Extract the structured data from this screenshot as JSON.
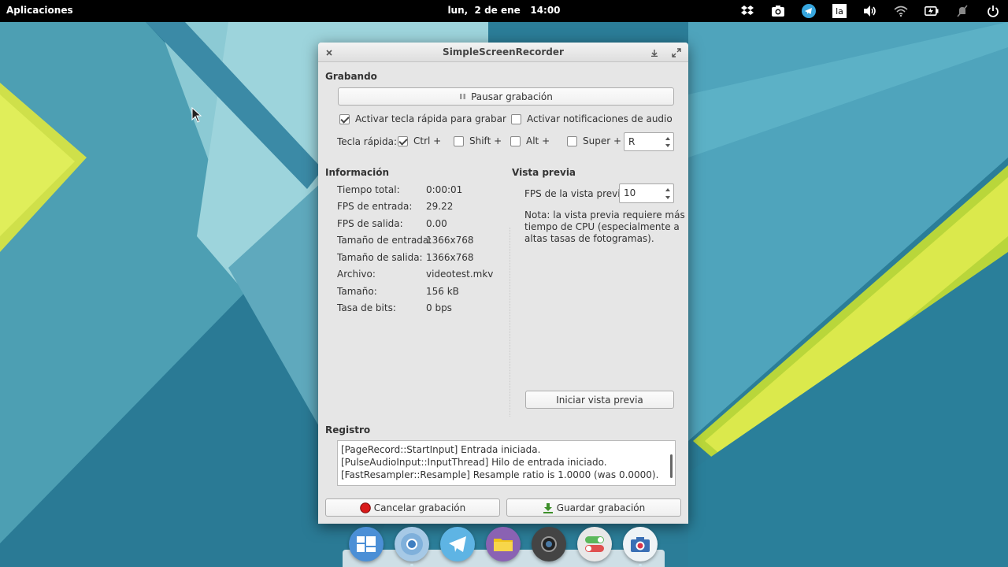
{
  "topbar": {
    "apps_label": "Aplicaciones",
    "clock": "lun,  2 de ene   14:00",
    "tray_icons": [
      "dropbox-icon",
      "camera-icon",
      "telegram-icon",
      "keyboard-layout-icon",
      "volume-icon",
      "wifi-icon",
      "battery-icon",
      "notifications-off-icon",
      "power-icon"
    ],
    "keyboard_layout": "la"
  },
  "window": {
    "title": "SimpleScreenRecorder",
    "recording": {
      "heading": "Grabando",
      "pause_button": "Pausar grabación",
      "hotkey_enable_label": "Activar tecla rápida para grabar",
      "hotkey_enable_checked": true,
      "audio_notif_label": "Activar notificaciones de audio",
      "audio_notif_checked": false,
      "hotkey_label": "Tecla rápida:",
      "modifiers": [
        {
          "label": "Ctrl +",
          "checked": true
        },
        {
          "label": "Shift +",
          "checked": false
        },
        {
          "label": "Alt +",
          "checked": false
        },
        {
          "label": "Super +",
          "checked": false
        }
      ],
      "key_value": "R"
    },
    "info": {
      "heading": "Información",
      "rows": [
        {
          "key": "Tiempo total:",
          "value": "0:00:01"
        },
        {
          "key": "FPS de entrada:",
          "value": "29.22"
        },
        {
          "key": "FPS de salida:",
          "value": "0.00"
        },
        {
          "key": "Tamaño de entrada:",
          "value": "1366x768"
        },
        {
          "key": "Tamaño de salida:",
          "value": "1366x768"
        },
        {
          "key": "Archivo:",
          "value": "videotest.mkv"
        },
        {
          "key": "Tamaño:",
          "value": "156 kB"
        },
        {
          "key": "Tasa de bits:",
          "value": "0 bps"
        }
      ]
    },
    "preview": {
      "heading": "Vista previa",
      "fps_label": "FPS de la vista previa:",
      "fps_value": "10",
      "note_lines": [
        "Nota: la vista previa requiere más",
        "tiempo de CPU (especialmente a",
        "altas tasas de fotogramas)."
      ],
      "start_button": "Iniciar vista previa"
    },
    "log": {
      "heading": "Registro",
      "lines": [
        "[PageRecord::StartInput] Entrada iniciada.",
        "[PulseAudioInput::InputThread] Hilo de entrada iniciado.",
        "[FastResampler::Resample] Resample ratio is 1.0000 (was 0.0000)."
      ]
    },
    "cancel_button": "Cancelar grabación",
    "save_button": "Guardar grabación"
  },
  "dock": {
    "apps": [
      "multitasking-view-icon",
      "chromium-icon",
      "telegram-icon",
      "files-icon",
      "screenshot-icon",
      "system-settings-icon",
      "camera-icon"
    ]
  },
  "colors": {
    "panel": "#000000",
    "window_bg": "#e6e6e6",
    "record_red": "#d91a1a",
    "save_green": "#3d8f2a"
  }
}
